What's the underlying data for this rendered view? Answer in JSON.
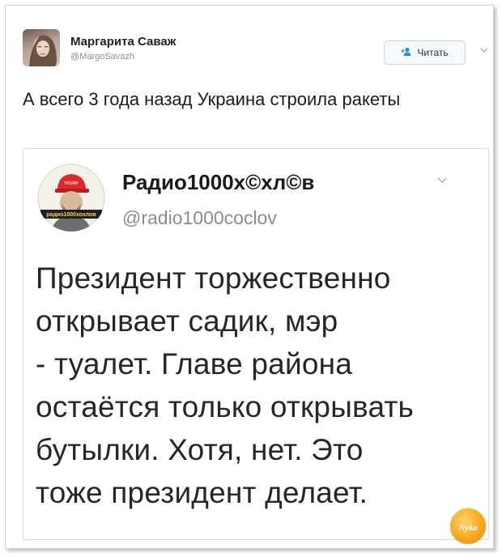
{
  "tweet": {
    "author_name": "Маргарита Саваж",
    "author_handle": "@MargoSavazh",
    "follow_label": "Читать",
    "text": "А всего 3 года назад Украина строила ракеты"
  },
  "quoted": {
    "author_name": "Радио1000х©хл©в",
    "author_handle": "@radio1000coclov",
    "avatar_badge": "радио 1000 хохлов",
    "text_lines": [
      "Президент торжественно",
      "открывает садик, мэр",
      "- туалет. Главе района",
      "остаётся только открывать",
      "бутылки. Хотя, нет. Это",
      "тоже президент делает."
    ]
  },
  "watermark": {
    "text": "Nyka"
  },
  "icons": {
    "follow": "add-user-icon",
    "menu": "chevron-down-icon"
  },
  "colors": {
    "accent": "#1b95e0",
    "text": "#1c1c1c",
    "muted": "#8a8f94"
  }
}
